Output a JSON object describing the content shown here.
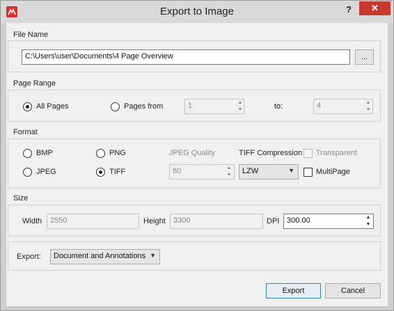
{
  "window": {
    "title": "Export to Image",
    "help_label": "?",
    "close_label": "✕"
  },
  "file_name": {
    "section_label": "File Name",
    "path": "C:\\Users\\user\\Documents\\4 Page Overview",
    "browse_label": "..."
  },
  "page_range": {
    "section_label": "Page Range",
    "all_pages_label": "All Pages",
    "pages_from_label": "Pages from",
    "from_value": "1",
    "to_label": "to:",
    "to_value": "4"
  },
  "format": {
    "section_label": "Format",
    "bmp_label": "BMP",
    "png_label": "PNG",
    "jpeg_label": "JPEG",
    "tiff_label": "TIFF",
    "jpeg_quality_label": "JPEG Quality",
    "jpeg_quality_value": "80",
    "tiff_compression_label": "TIFF Compression",
    "tiff_compression_value": "LZW",
    "transparent_label": "Transparent",
    "multipage_label": "MultiPage"
  },
  "size": {
    "section_label": "Size",
    "width_label": "Width",
    "width_value": "2550",
    "height_label": "Height",
    "height_value": "3300",
    "dpi_label": "DPI",
    "dpi_value": "300.00"
  },
  "export_options": {
    "label": "Export:",
    "value": "Document and Annotations"
  },
  "buttons": {
    "export_label": "Export",
    "cancel_label": "Cancel"
  }
}
